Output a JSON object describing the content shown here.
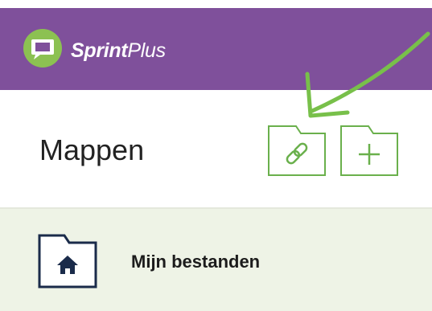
{
  "header": {
    "brand_bold": "Sprint",
    "brand_regular": "Plus",
    "logo_icon": "chat-bubble-icon",
    "colors": {
      "background": "#7f509b",
      "logo_ring": "#8cc152"
    }
  },
  "main": {
    "title": "Mappen",
    "buttons": [
      {
        "name": "link-folder-button",
        "icon": "link-folder-icon"
      },
      {
        "name": "add-folder-button",
        "icon": "plus-folder-icon"
      }
    ],
    "button_color": "#6ab04c",
    "annotation_arrow_color": "#78c04a"
  },
  "folders": [
    {
      "label": "Mijn bestanden",
      "icon": "home-folder-icon"
    }
  ],
  "colors": {
    "list_background": "#eef3e6",
    "folder_outline": "#1a2b4a"
  }
}
